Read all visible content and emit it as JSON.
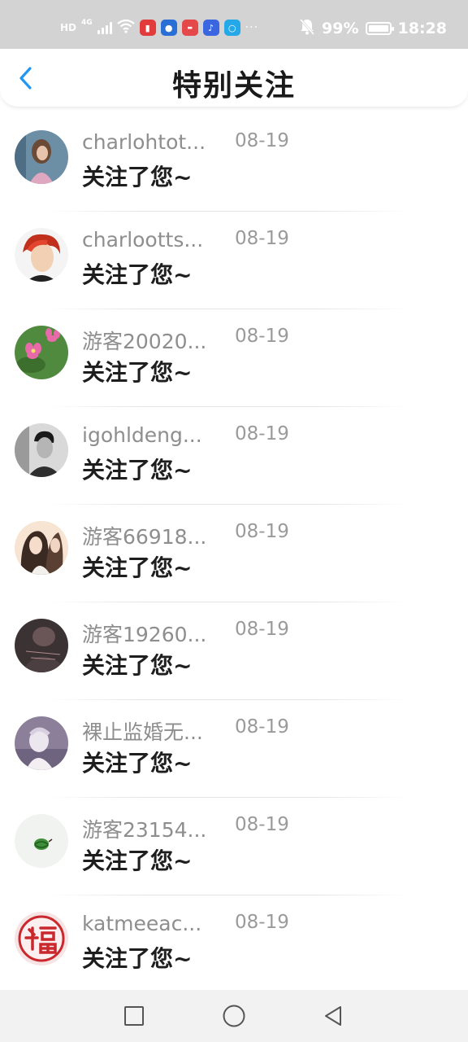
{
  "status_bar": {
    "hd": "HD",
    "network": "4G",
    "battery_percent": "99%",
    "battery_level": 0.99,
    "time": "18:28",
    "overflow": "···",
    "icons": [
      "signal-icon",
      "wifi-icon",
      "red-app-icon",
      "blue-bulb-app-icon",
      "red-tv-app-icon",
      "music-app-icon",
      "search-app-icon",
      "mute-bell-icon",
      "battery-icon"
    ]
  },
  "header": {
    "title": "特别关注",
    "back_icon": "chevron-left-icon",
    "accent_color": "#2196f3"
  },
  "items": [
    {
      "name": "charlohtot...",
      "date": "08-19",
      "message": "关注了您~"
    },
    {
      "name": "charlootts...",
      "date": "08-19",
      "message": "关注了您~"
    },
    {
      "name": "游客20020...",
      "date": "08-19",
      "message": "关注了您~"
    },
    {
      "name": "igohldeng...",
      "date": "08-19",
      "message": "关注了您~"
    },
    {
      "name": "游客66918...",
      "date": "08-19",
      "message": "关注了您~"
    },
    {
      "name": "游客19260...",
      "date": "08-19",
      "message": "关注了您~"
    },
    {
      "name": "裸止监婚无...",
      "date": "08-19",
      "message": "关注了您~"
    },
    {
      "name": "游客23154...",
      "date": "08-19",
      "message": "关注了您~"
    },
    {
      "name": "katmeeac...",
      "date": "08-19",
      "message": "关注了您~"
    }
  ],
  "nav_bar": {
    "icons": [
      "square-recents-icon",
      "circle-home-icon",
      "triangle-back-icon"
    ]
  }
}
